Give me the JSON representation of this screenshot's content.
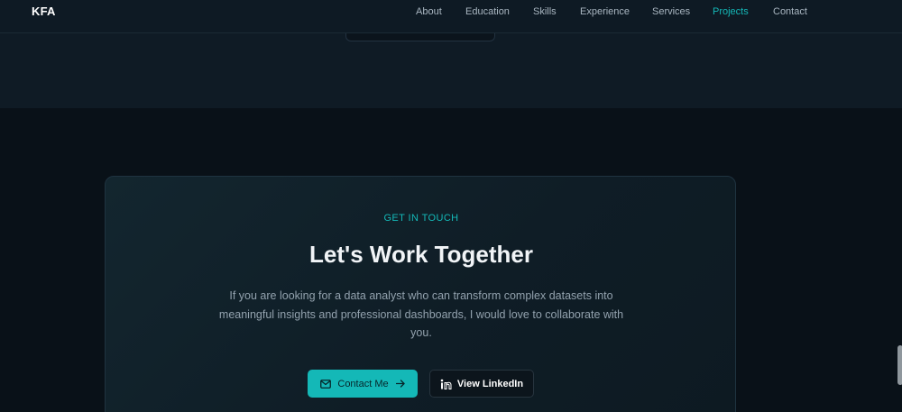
{
  "navbar": {
    "brand": "KFA",
    "links": [
      {
        "label": "About",
        "active": false
      },
      {
        "label": "Education",
        "active": false
      },
      {
        "label": "Skills",
        "active": false
      },
      {
        "label": "Experience",
        "active": false
      },
      {
        "label": "Services",
        "active": false
      },
      {
        "label": "Projects",
        "active": true
      },
      {
        "label": "Contact",
        "active": false
      }
    ]
  },
  "cta": {
    "eyebrow": "GET IN TOUCH",
    "title": "Let's Work Together",
    "body": "If you are looking for a data analyst who can transform complex datasets into meaningful insights and professional dashboards, I would love to collaborate with you.",
    "primary_button": {
      "label": "Contact Me",
      "icon_left": "mail-icon",
      "icon_right": "arrow-right-icon"
    },
    "secondary_button": {
      "label": "View LinkedIn",
      "icon_left": "linkedin-icon"
    }
  },
  "colors": {
    "accent": "#14b8b7",
    "background": "#0b141c",
    "text_primary": "#f1f4f7",
    "text_muted": "#93a2ae"
  }
}
